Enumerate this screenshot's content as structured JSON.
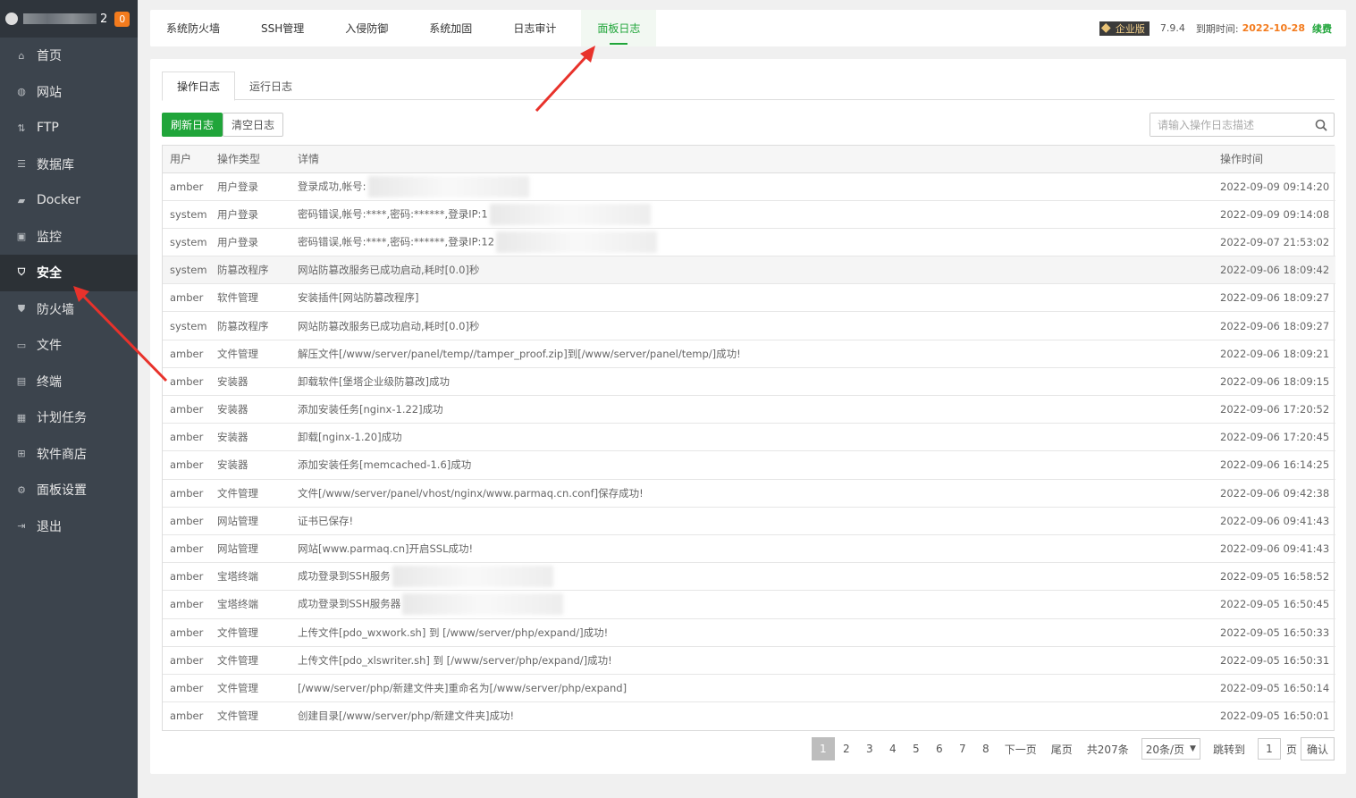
{
  "sidebar": {
    "header_num": "2",
    "badge": "0",
    "items": [
      {
        "label": "首页",
        "icon": "home-icon",
        "glyph": "⌂"
      },
      {
        "label": "网站",
        "icon": "globe-icon",
        "glyph": "◍"
      },
      {
        "label": "FTP",
        "icon": "ftp-icon",
        "glyph": "⇅"
      },
      {
        "label": "数据库",
        "icon": "database-icon",
        "glyph": "☰"
      },
      {
        "label": "Docker",
        "icon": "docker-icon",
        "glyph": "▰"
      },
      {
        "label": "监控",
        "icon": "monitor-icon",
        "glyph": "▣"
      },
      {
        "label": "安全",
        "icon": "shield-check-icon",
        "glyph": "⛉"
      },
      {
        "label": "防火墙",
        "icon": "firewall-shield-icon",
        "glyph": "⛊"
      },
      {
        "label": "文件",
        "icon": "folder-icon",
        "glyph": "▭"
      },
      {
        "label": "终端",
        "icon": "terminal-icon",
        "glyph": "▤"
      },
      {
        "label": "计划任务",
        "icon": "calendar-icon",
        "glyph": "▦"
      },
      {
        "label": "软件商店",
        "icon": "apps-grid-icon",
        "glyph": "⊞"
      },
      {
        "label": "面板设置",
        "icon": "gear-icon",
        "glyph": "⚙"
      },
      {
        "label": "退出",
        "icon": "logout-icon",
        "glyph": "⇥"
      }
    ]
  },
  "topnav": {
    "tabs": [
      "系统防火墙",
      "SSH管理",
      "入侵防御",
      "系统加固",
      "日志审计",
      "面板日志"
    ],
    "edition": "企业版",
    "version": "7.9.4",
    "expire_label": "到期时间:",
    "expire_date": "2022-10-28",
    "renew": "续费"
  },
  "subtabs": [
    "操作日志",
    "运行日志"
  ],
  "toolbar": {
    "refresh": "刷新日志",
    "clear": "清空日志",
    "search_placeholder": "请输入操作日志描述"
  },
  "table": {
    "headers": [
      "用户",
      "操作类型",
      "详情",
      "操作时间"
    ],
    "rows": [
      {
        "user": "amber",
        "type": "用户登录",
        "detail": "登录成功,帐号:",
        "time": "2022-09-09 09:14:20",
        "blur": true
      },
      {
        "user": "system",
        "type": "用户登录",
        "detail": "密码错误,帐号:****,密码:******,登录IP:1",
        "time": "2022-09-09 09:14:08",
        "blur": true
      },
      {
        "user": "system",
        "type": "用户登录",
        "detail": "密码错误,帐号:****,密码:******,登录IP:12",
        "time": "2022-09-07 21:53:02",
        "blur": true
      },
      {
        "user": "system",
        "type": "防篡改程序",
        "detail": "网站防篡改服务已成功启动,耗时[0.0]秒",
        "time": "2022-09-06 18:09:42"
      },
      {
        "user": "amber",
        "type": "软件管理",
        "detail": "安装插件[网站防篡改程序]",
        "time": "2022-09-06 18:09:27"
      },
      {
        "user": "system",
        "type": "防篡改程序",
        "detail": "网站防篡改服务已成功启动,耗时[0.0]秒",
        "time": "2022-09-06 18:09:27"
      },
      {
        "user": "amber",
        "type": "文件管理",
        "detail": "解压文件[/www/server/panel/temp//tamper_proof.zip]到[/www/server/panel/temp/]成功!",
        "time": "2022-09-06 18:09:21"
      },
      {
        "user": "amber",
        "type": "安装器",
        "detail": "卸载软件[堡塔企业级防篡改]成功",
        "time": "2022-09-06 18:09:15"
      },
      {
        "user": "amber",
        "type": "安装器",
        "detail": "添加安装任务[nginx-1.22]成功",
        "time": "2022-09-06 17:20:52"
      },
      {
        "user": "amber",
        "type": "安装器",
        "detail": "卸载[nginx-1.20]成功",
        "time": "2022-09-06 17:20:45"
      },
      {
        "user": "amber",
        "type": "安装器",
        "detail": "添加安装任务[memcached-1.6]成功",
        "time": "2022-09-06 16:14:25"
      },
      {
        "user": "amber",
        "type": "文件管理",
        "detail": "文件[/www/server/panel/vhost/nginx/www.parmaq.cn.conf]保存成功!",
        "time": "2022-09-06 09:42:38"
      },
      {
        "user": "amber",
        "type": "网站管理",
        "detail": "证书已保存!",
        "time": "2022-09-06 09:41:43"
      },
      {
        "user": "amber",
        "type": "网站管理",
        "detail": "网站[www.parmaq.cn]开启SSL成功!",
        "time": "2022-09-06 09:41:43"
      },
      {
        "user": "amber",
        "type": "宝塔终端",
        "detail": "成功登录到SSH服务",
        "time": "2022-09-05 16:58:52",
        "blur": true
      },
      {
        "user": "amber",
        "type": "宝塔终端",
        "detail": "成功登录到SSH服务器",
        "time": "2022-09-05 16:50:45",
        "blur": true
      },
      {
        "user": "amber",
        "type": "文件管理",
        "detail": "上传文件[pdo_wxwork.sh] 到 [/www/server/php/expand/]成功!",
        "time": "2022-09-05 16:50:33"
      },
      {
        "user": "amber",
        "type": "文件管理",
        "detail": "上传文件[pdo_xlswriter.sh] 到 [/www/server/php/expand/]成功!",
        "time": "2022-09-05 16:50:31"
      },
      {
        "user": "amber",
        "type": "文件管理",
        "detail": "[/www/server/php/新建文件夹]重命名为[/www/server/php/expand]",
        "time": "2022-09-05 16:50:14"
      },
      {
        "user": "amber",
        "type": "文件管理",
        "detail": "创建目录[/www/server/php/新建文件夹]成功!",
        "time": "2022-09-05 16:50:01"
      }
    ]
  },
  "pager": {
    "pages": [
      "1",
      "2",
      "3",
      "4",
      "5",
      "6",
      "7",
      "8"
    ],
    "next": "下一页",
    "last": "尾页",
    "total": "共207条",
    "per_page": "20条/页",
    "jump_label": "跳转到",
    "jump_value": "1",
    "page_unit": "页",
    "confirm": "确认"
  },
  "colors": {
    "accent": "#20a53a",
    "sidebar_bg": "#3c444d",
    "expire": "#f37b1d",
    "arrow": "#e8322b"
  }
}
